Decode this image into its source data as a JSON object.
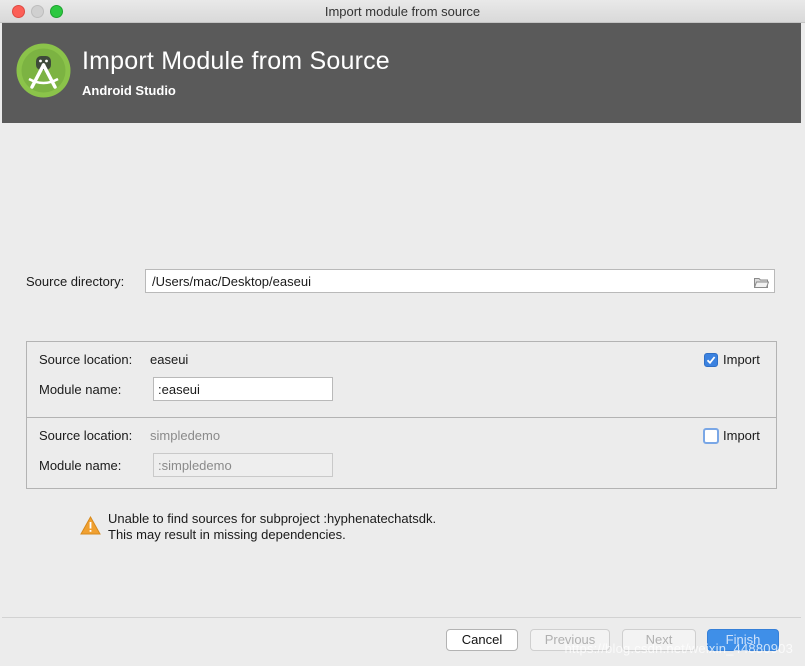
{
  "window": {
    "title": "Import module from source"
  },
  "header": {
    "title": "Import Module from Source",
    "subtitle": "Android Studio"
  },
  "source_directory": {
    "label": "Source directory:",
    "value": "/Users/mac/Desktop/easeui",
    "browse_icon": "folder-open-icon"
  },
  "modules": [
    {
      "location_label": "Source location:",
      "location_value": "easeui",
      "name_label": "Module name:",
      "name_value": ":easeui",
      "import_label": "Import",
      "import_checked": true
    },
    {
      "location_label": "Source location:",
      "location_value": "simpledemo",
      "name_label": "Module name:",
      "name_value": ":simpledemo",
      "import_label": "Import",
      "import_checked": false
    }
  ],
  "warning": {
    "icon": "warning-icon",
    "line1": "Unable to find sources for subproject :hyphenatechatsdk.",
    "line2": "This may result in missing dependencies."
  },
  "buttons": {
    "cancel": "Cancel",
    "previous": "Previous",
    "next": "Next",
    "finish": "Finish"
  },
  "watermark": "https://blog.csdn.net/weixin_44880903",
  "colors": {
    "header_bg": "#5a5a5a",
    "accent": "#3f8fe8",
    "logo_green": "#8bc34a",
    "warning": "#f0a030"
  }
}
